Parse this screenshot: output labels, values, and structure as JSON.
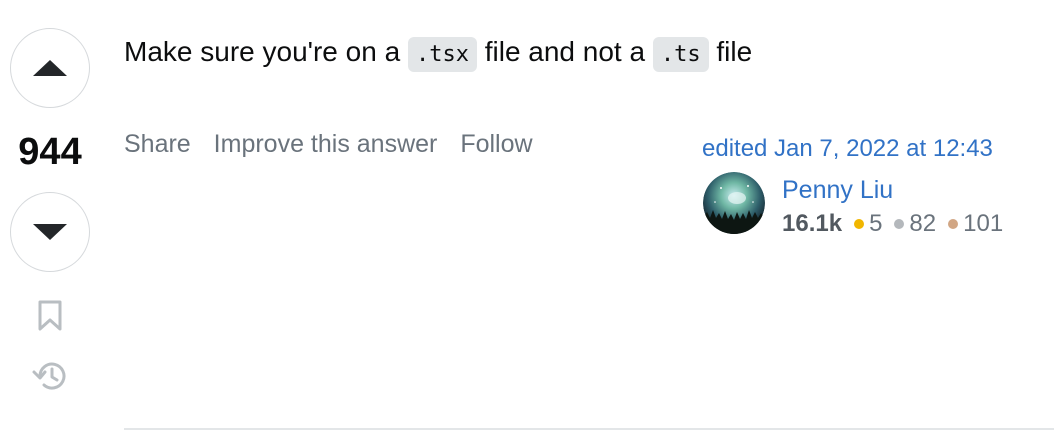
{
  "vote": {
    "score": "944"
  },
  "answer": {
    "text_before": "Make sure you're on a",
    "code_1": ".tsx",
    "text_middle": "file and not a",
    "code_2": ".ts",
    "text_after": "file"
  },
  "actions": {
    "share": "Share",
    "improve": "Improve this answer",
    "follow": "Follow"
  },
  "edit_info": {
    "label": "edited Jan 7, 2022 at 12:43"
  },
  "user": {
    "name": "Penny Liu",
    "reputation": "16.1k",
    "badges": [
      {
        "count": "5",
        "color": "#f1b600"
      },
      {
        "count": "82",
        "color": "#b4b8bc"
      },
      {
        "count": "101",
        "color": "#d1a684"
      }
    ]
  },
  "icons": [
    "arrow-up-icon",
    "arrow-down-icon",
    "bookmark-icon",
    "history-icon"
  ]
}
